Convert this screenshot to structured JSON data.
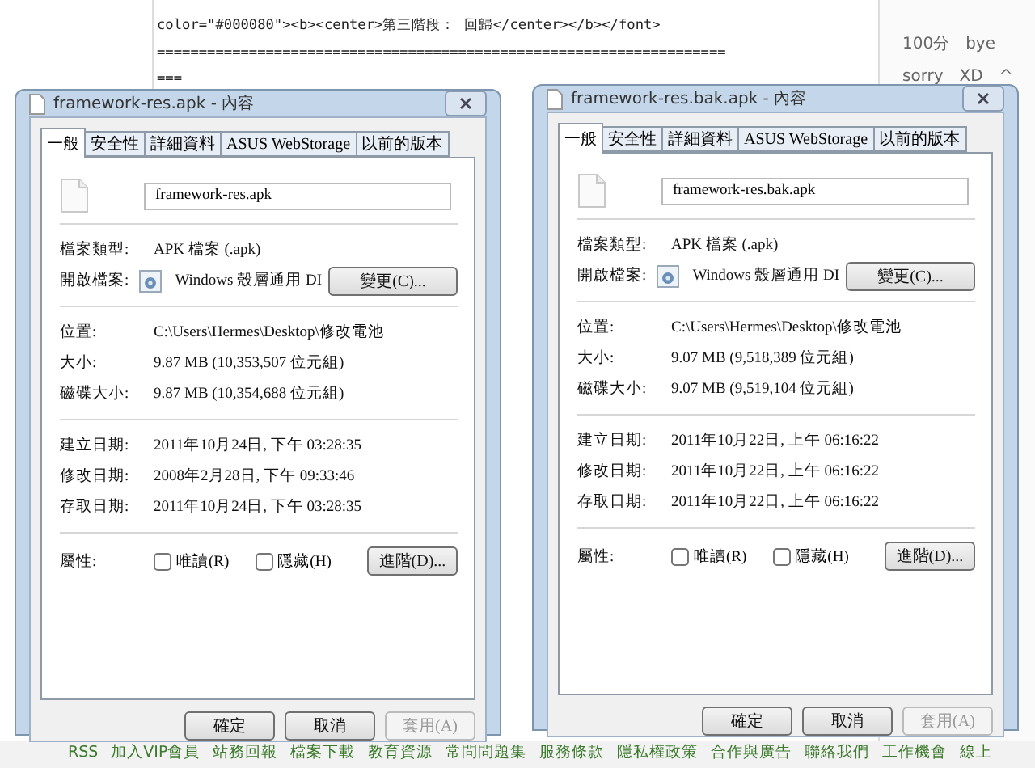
{
  "background": {
    "code_lines": [
      "color=\"#000080\"><b><center>第三階段： 回歸</center></b></font>",
      "====================================================================",
      "==="
    ],
    "sidebar_items": [
      "100分　bye",
      "sorry　XD　^"
    ],
    "footer_links": [
      "RSS",
      "加入VIP會員",
      "站務回報",
      "檔案下載",
      "教育資源",
      "常問問題集",
      "服務條款",
      "隱私權政策",
      "合作與廣告",
      "聯絡我們",
      "工作機會",
      "線上"
    ]
  },
  "dialogs": [
    {
      "title": "framework-res.apk - 內容",
      "tabs": [
        {
          "label": "一般",
          "selected": true
        },
        {
          "label": "安全性",
          "selected": false
        },
        {
          "label": "詳細資料",
          "selected": false
        },
        {
          "label": "ASUS WebStorage",
          "selected": false
        },
        {
          "label": "以前的版本",
          "selected": false
        }
      ],
      "file_name": "framework-res.apk",
      "file_type": {
        "label": "檔案類型:",
        "value": "APK 檔案 (.apk)"
      },
      "opens_with": {
        "label": "開啟檔案:",
        "value": "Windows 殼層通用 DI",
        "button": "變更(C)..."
      },
      "info_groups": [
        [
          {
            "label": "位置:",
            "value": "C:\\Users\\Hermes\\Desktop\\修改電池"
          },
          {
            "label": "大小:",
            "value": "9.87 MB (10,353,507 位元組)"
          },
          {
            "label": "磁碟大小:",
            "value": "9.87 MB (10,354,688 位元組)"
          }
        ],
        [
          {
            "label": "建立日期:",
            "value": "2011年10月24日, 下午 03:28:35"
          },
          {
            "label": "修改日期:",
            "value": "2008年2月28日, 下午 09:33:46"
          },
          {
            "label": "存取日期:",
            "value": "2011年10月24日, 下午 03:28:35"
          }
        ]
      ],
      "attributes": {
        "label": "屬性:",
        "checkboxes": [
          {
            "label": "唯讀(R)",
            "checked": false
          },
          {
            "label": "隱藏(H)",
            "checked": false
          }
        ],
        "button": "進階(D)..."
      },
      "buttons": [
        {
          "label": "確定",
          "disabled": false
        },
        {
          "label": "取消",
          "disabled": false
        },
        {
          "label": "套用(A)",
          "disabled": true
        }
      ]
    },
    {
      "title": "framework-res.bak.apk - 內容",
      "tabs": [
        {
          "label": "一般",
          "selected": true
        },
        {
          "label": "安全性",
          "selected": false
        },
        {
          "label": "詳細資料",
          "selected": false
        },
        {
          "label": "ASUS WebStorage",
          "selected": false
        },
        {
          "label": "以前的版本",
          "selected": false
        }
      ],
      "file_name": "framework-res.bak.apk",
      "file_type": {
        "label": "檔案類型:",
        "value": "APK 檔案 (.apk)"
      },
      "opens_with": {
        "label": "開啟檔案:",
        "value": "Windows 殼層通用 DI",
        "button": "變更(C)..."
      },
      "info_groups": [
        [
          {
            "label": "位置:",
            "value": "C:\\Users\\Hermes\\Desktop\\修改電池"
          },
          {
            "label": "大小:",
            "value": "9.07 MB (9,518,389 位元組)"
          },
          {
            "label": "磁碟大小:",
            "value": "9.07 MB (9,519,104 位元組)"
          }
        ],
        [
          {
            "label": "建立日期:",
            "value": "2011年10月22日, 上午 06:16:22"
          },
          {
            "label": "修改日期:",
            "value": "2011年10月22日, 上午 06:16:22"
          },
          {
            "label": "存取日期:",
            "value": "2011年10月22日, 上午 06:16:22"
          }
        ]
      ],
      "attributes": {
        "label": "屬性:",
        "checkboxes": [
          {
            "label": "唯讀(R)",
            "checked": false
          },
          {
            "label": "隱藏(H)",
            "checked": false
          }
        ],
        "button": "進階(D)..."
      },
      "buttons": [
        {
          "label": "確定",
          "disabled": false
        },
        {
          "label": "取消",
          "disabled": false
        },
        {
          "label": "套用(A)",
          "disabled": true
        }
      ]
    }
  ]
}
